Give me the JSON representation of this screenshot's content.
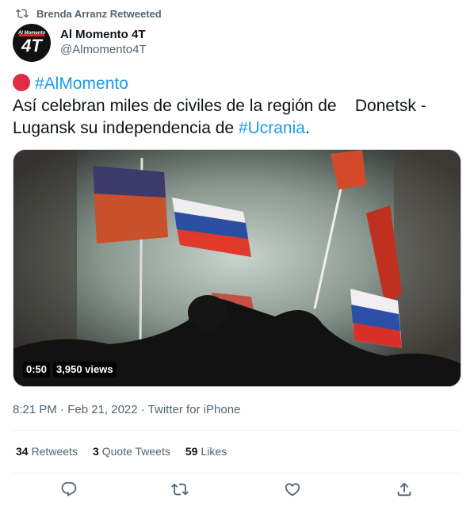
{
  "retweet_banner": {
    "text": "Brenda Arranz Retweeted",
    "icon": "retweet-icon"
  },
  "author": {
    "display_name": "Al Momento 4T",
    "handle": "@Almomento4T",
    "avatar_top": "Al Momento",
    "avatar_main": "4T"
  },
  "tweet": {
    "line1_emoji": "red-circle",
    "line1_hashtag": "#AlMomento",
    "line2_text": "Así celebran miles de civiles de la región de    Donetsk -",
    "line3_text_before": "Lugansk su independencia de ",
    "line3_hashtag": "#Ucrania",
    "line3_after": "."
  },
  "media": {
    "duration": "0:50",
    "views": "3,950 views"
  },
  "meta": {
    "timestamp": "8:21 PM · Feb 21, 2022 · Twitter for iPhone"
  },
  "stats": {
    "retweets_num": "34",
    "retweets_label": "Retweets",
    "quotes_num": "3",
    "quotes_label": "Quote Tweets",
    "likes_num": "59",
    "likes_label": "Likes"
  },
  "actions": [
    "reply-icon",
    "retweet-icon",
    "like-icon",
    "share-icon"
  ],
  "colors": {
    "accent": "#1d9bf0",
    "secondary_text": "#536471",
    "primary_text": "#0f1419"
  }
}
